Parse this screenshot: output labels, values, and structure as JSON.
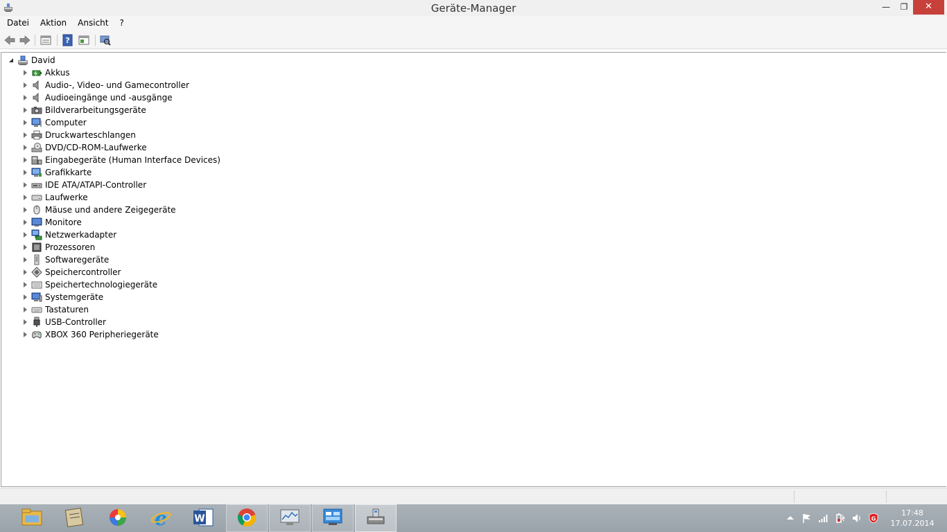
{
  "window": {
    "title": "Geräte-Manager",
    "min_glyph": "—",
    "max_glyph": "❐",
    "close_glyph": "✕"
  },
  "menu": [
    "Datei",
    "Aktion",
    "Ansicht",
    "?"
  ],
  "toolbar": {
    "buttons": [
      "back-arrow-icon",
      "forward-arrow-icon",
      "properties-icon",
      "help-icon",
      "show-hide-console-tree-icon",
      "scan-hardware-icon"
    ]
  },
  "tree": {
    "root": "David",
    "items": [
      {
        "label": "Akkus",
        "icon": "battery-icon"
      },
      {
        "label": "Audio-, Video- und Gamecontroller",
        "icon": "speaker-icon"
      },
      {
        "label": "Audioeingänge und -ausgänge",
        "icon": "speaker-icon"
      },
      {
        "label": "Bildverarbeitungsgeräte",
        "icon": "camera-icon"
      },
      {
        "label": "Computer",
        "icon": "computer-icon"
      },
      {
        "label": "Druckwarteschlangen",
        "icon": "printer-icon"
      },
      {
        "label": "DVD/CD-ROM-Laufwerke",
        "icon": "disc-drive-icon"
      },
      {
        "label": "Eingabegeräte (Human Interface Devices)",
        "icon": "hid-icon"
      },
      {
        "label": "Grafikkarte",
        "icon": "display-adapter-icon"
      },
      {
        "label": "IDE ATA/ATAPI-Controller",
        "icon": "ide-controller-icon"
      },
      {
        "label": "Laufwerke",
        "icon": "disk-drive-icon"
      },
      {
        "label": "Mäuse und andere Zeigegeräte",
        "icon": "mouse-icon"
      },
      {
        "label": "Monitore",
        "icon": "monitor-icon"
      },
      {
        "label": "Netzwerkadapter",
        "icon": "network-adapter-icon"
      },
      {
        "label": "Prozessoren",
        "icon": "processor-icon"
      },
      {
        "label": "Softwaregeräte",
        "icon": "software-device-icon"
      },
      {
        "label": "Speichercontroller",
        "icon": "storage-controller-icon"
      },
      {
        "label": "Speichertechnologiegeräte",
        "icon": "memory-technology-icon"
      },
      {
        "label": "Systemgeräte",
        "icon": "system-device-icon"
      },
      {
        "label": "Tastaturen",
        "icon": "keyboard-icon"
      },
      {
        "label": "USB-Controller",
        "icon": "usb-icon"
      },
      {
        "label": "XBOX 360 Peripheriegeräte",
        "icon": "gamepad-icon"
      }
    ]
  },
  "taskbar": {
    "apps": [
      "file-explorer-icon",
      "notepad-app-icon",
      "picasa-icon",
      "internet-explorer-icon",
      "word-icon",
      "chrome-icon",
      "system-monitor-icon",
      "control-panel-icon",
      "device-manager-icon"
    ],
    "tray": [
      "show-hidden-icons-icon",
      "action-center-flag-icon",
      "network-signal-icon",
      "power-icon",
      "volume-icon",
      "gdata-antivirus-icon"
    ]
  },
  "clock": {
    "time": "17:48",
    "date": "17.07.2014"
  }
}
